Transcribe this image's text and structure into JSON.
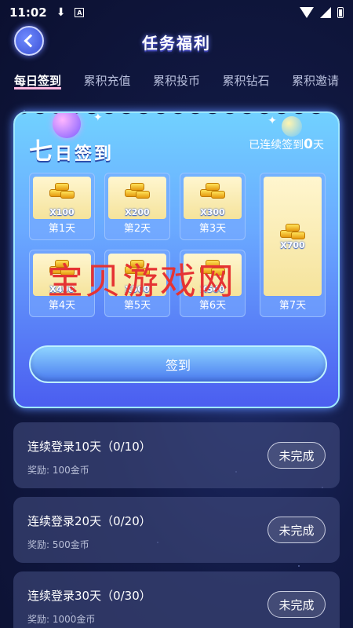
{
  "status_bar": {
    "time": "11:02"
  },
  "header": {
    "title": "任务福利"
  },
  "tabs": [
    "每日签到",
    "累积充值",
    "累积投币",
    "累积钻石",
    "累积邀请"
  ],
  "signin": {
    "title_big": "七",
    "title_rest": "日签到",
    "streak_prefix": "已连续签到",
    "streak_num": "0",
    "streak_suffix": "天",
    "days": [
      {
        "amount": "X100",
        "label": "第1天"
      },
      {
        "amount": "X200",
        "label": "第2天"
      },
      {
        "amount": "X300",
        "label": "第3天"
      },
      {
        "amount": "X400",
        "label": "第4天"
      },
      {
        "amount": "X500",
        "label": "第5天"
      },
      {
        "amount": "X500",
        "label": "第6天"
      },
      {
        "amount": "X700",
        "label": "第7天"
      }
    ],
    "button_label": "签到"
  },
  "tasks": [
    {
      "title": "连续登录10天（0/10）",
      "reward": "奖励: 100金币",
      "button": "未完成"
    },
    {
      "title": "连续登录20天（0/20）",
      "reward": "奖励: 500金币",
      "button": "未完成"
    },
    {
      "title": "连续登录30天（0/30）",
      "reward": "奖励: 1000金币",
      "button": "未完成"
    }
  ],
  "watermark": "宝贝游戏网",
  "colors": {
    "accent": "#4a7af0",
    "card_top": "#71d1ff",
    "watermark": "#e53333"
  }
}
